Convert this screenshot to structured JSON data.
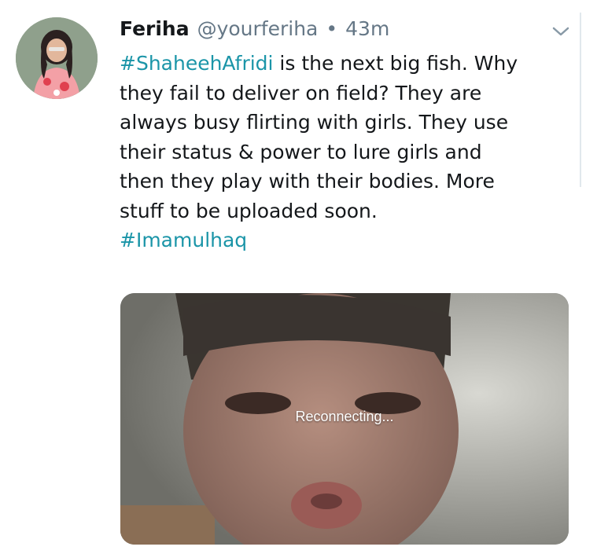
{
  "tweet": {
    "author": {
      "display_name": "Feriha",
      "handle": "@yourferiha",
      "separator": "•",
      "timestamp": "43m"
    },
    "body": {
      "line1_hashtag": "#ShaheehAfridi",
      "line1_text": " is the next big fish. Why",
      "line2": "they fail to deliver on field? They are",
      "line3": "always busy flirting with girls. They use",
      "line4": "their status & power to lure girls and",
      "line5": "then they play with their bodies. More",
      "line6": "stuff to be uploaded soon.",
      "line7_hashtag": "#Imamulhaq"
    },
    "media": {
      "overlay_text": "Reconnecting..."
    }
  },
  "colors": {
    "hashtag": "#1b95a8",
    "text": "#14171a",
    "muted": "#657786"
  },
  "icons": {
    "menu": "chevron-down-icon",
    "avatar": "profile-photo"
  }
}
